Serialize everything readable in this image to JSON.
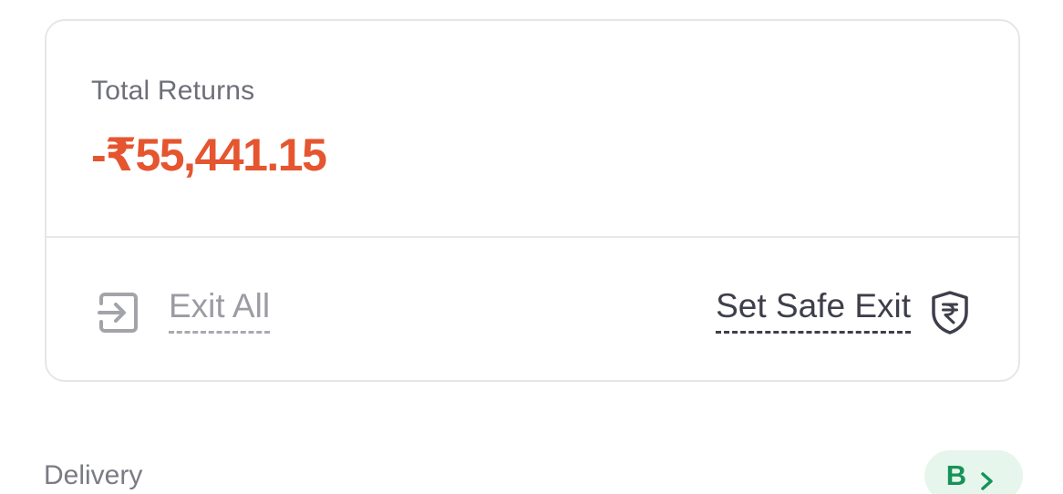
{
  "returns_card": {
    "label": "Total Returns",
    "value": "-₹55,441.15",
    "value_color": "#e5552f"
  },
  "actions": {
    "exit_all_label": "Exit All",
    "exit_all_icon": "exit-arrow-icon",
    "safe_exit_label": "Set Safe Exit",
    "safe_exit_icon": "rupee-shield-icon"
  },
  "delivery": {
    "label": "Delivery",
    "badge_label": "B",
    "badge_icon": "chevron-right-icon",
    "badge_color": "#16935a"
  }
}
